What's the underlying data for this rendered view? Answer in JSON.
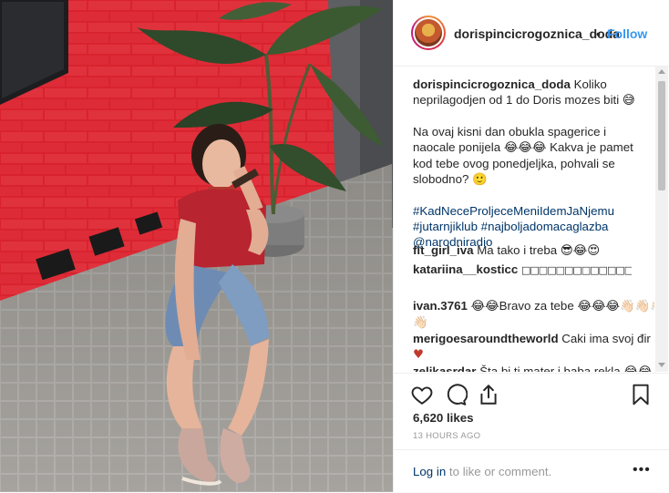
{
  "header": {
    "username": "dorispincicrogoznica_doda",
    "separator": "•",
    "follow_label": "Follow"
  },
  "caption": {
    "username": "dorispincicrogoznica_doda",
    "line1": "Koliko neprilagodjen od 1 do Doris mozes biti",
    "line1_emoji": "😅",
    "para2": "Na ovaj kisni dan obukla spagerice i naocale ponijela",
    "para2_emoji": "😂😂😂",
    "para2_cont": "Kakva je pamet kod tebe ovog ponedjeljka, pohvali se slobodno?",
    "para2_end_emoji": "🙂",
    "hashtags": [
      "#KadNeceProljeceMeniIdemJaNjemu",
      "#jutarnjiklub",
      "#najboljadomacaglazba"
    ],
    "mention": "@narodniradio"
  },
  "comments": [
    {
      "username": "fit_girl_iva",
      "text": "Ma tako i treba",
      "emoji": "😎😂😍"
    },
    {
      "username": "katariina__kosticc",
      "text": "",
      "emoji": "□□□□□□□□□□□□□□□□□□□□□□□□□□□□□□□□□□"
    },
    {
      "username": "ivan.3761",
      "text": "Bravo za tebe",
      "emoji_pre": "😂😂",
      "emoji": "😂😂😂👋🏻👋🏻👋🏻",
      "line2_emoji": "👋🏻"
    },
    {
      "username": "merigoesaroundtheworld",
      "text": "Caki ima svoj đir",
      "emoji": "♥"
    },
    {
      "username": "zelikasrdar",
      "text": "Šta bi ti mater i baba rekla",
      "emoji": "😂😂"
    }
  ],
  "actions": {
    "like_icon": "heart-icon",
    "comment_icon": "comment-icon",
    "share_icon": "share-icon",
    "save_icon": "bookmark-icon"
  },
  "likes_text": "6,620 likes",
  "timestamp": "13 HOURS AGO",
  "footer": {
    "login_link": "Log in",
    "login_rest": " to like or comment.",
    "more_label": "•••"
  },
  "colors": {
    "follow_blue": "#3897f0",
    "link_blue": "#003569",
    "brick_red": "#d8232f"
  }
}
